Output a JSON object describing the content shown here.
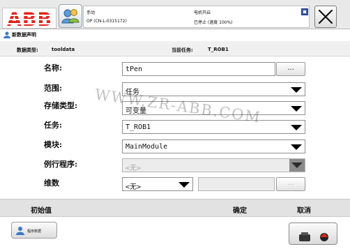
{
  "brand": {
    "logo_text": "ABB",
    "brand_color": "#e2231a"
  },
  "status": {
    "mode": "手动",
    "controller": "OP (CN-L-0315172)",
    "motor_state": "电机开启",
    "run_state": "已停止 (速度 100%)"
  },
  "window": {
    "title": "新数据声明",
    "title_icon": "program-data-icon"
  },
  "subheader": {
    "data_type_label": "数据类型:",
    "data_type_value": "tooldata",
    "task_label": "当前任务:",
    "task_value": "T_ROB1"
  },
  "form": {
    "name": {
      "label": "名称:",
      "value": "tPen",
      "button": "..."
    },
    "scope": {
      "label": "范围:",
      "value": "任务"
    },
    "storage_type": {
      "label": "存储类型:",
      "value": "可变量"
    },
    "task": {
      "label": "任务:",
      "value": "T_ROB1"
    },
    "module": {
      "label": "模块:",
      "value": "MainModule"
    },
    "routine": {
      "label": "例行程序:",
      "value": "<无>"
    },
    "dimension": {
      "label": "维数",
      "value": "<无>",
      "button": "..."
    }
  },
  "actions": {
    "init_label": "初始值",
    "ok_label": "确定",
    "cancel_label": "取消"
  },
  "taskbar": {
    "item_label": "程序数据"
  },
  "watermark": {
    "text": "WWW.ZR-ABB.COM"
  },
  "colors": {
    "accent": "#e2231a",
    "disabled": "#ececec",
    "bar": "#e2e2e2"
  }
}
